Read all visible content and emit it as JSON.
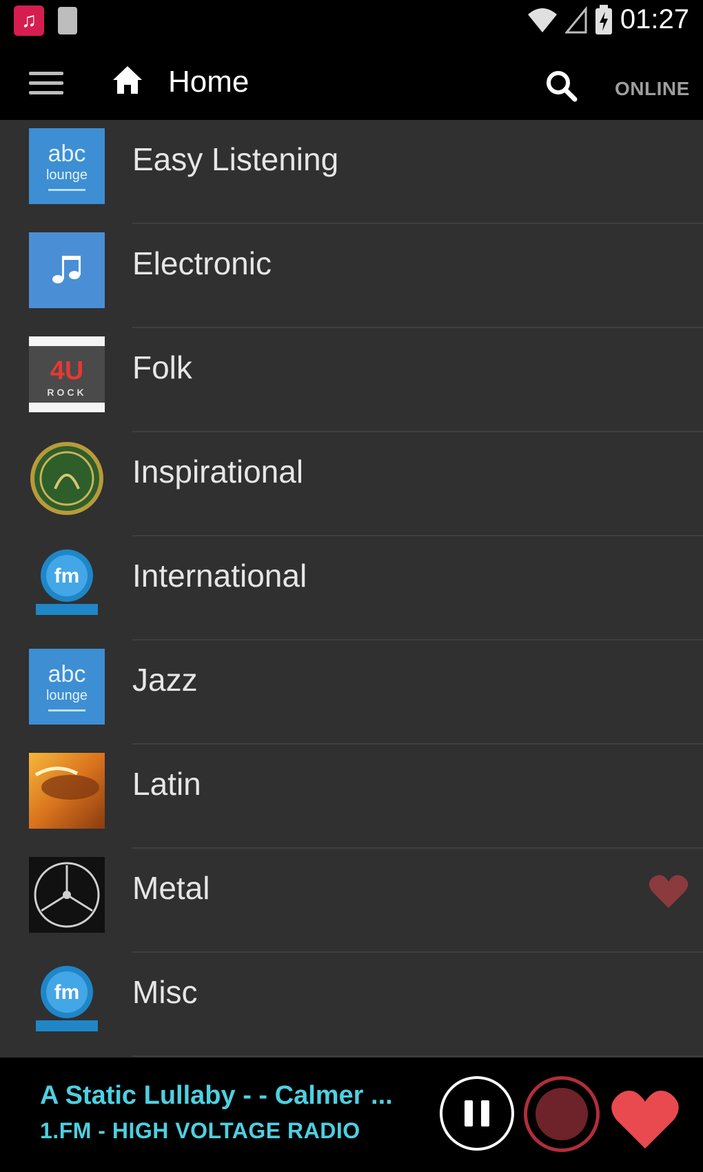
{
  "status_bar": {
    "time": "01:27",
    "app_icon": "music-note-icon",
    "sim_icon": "sim-card-icon",
    "wifi_icon": "wifi-icon",
    "signal_icon": "cell-signal-icon",
    "battery_icon": "battery-charging-icon"
  },
  "toolbar": {
    "title": "Home",
    "menu_icon": "hamburger-menu-icon",
    "home_icon": "home-icon",
    "search_icon": "search-icon",
    "online_label": "ONLINE"
  },
  "genres": [
    {
      "label": "Easy Listening",
      "thumb": "abc-lounge-radio-logo",
      "favorite": false
    },
    {
      "label": "Electronic",
      "thumb": "music-note-icon",
      "favorite": false
    },
    {
      "label": "Folk",
      "thumb": "4u-rock-logo",
      "favorite": false
    },
    {
      "label": "Inspirational",
      "thumb": "green-emblem-logo",
      "favorite": false
    },
    {
      "label": "International",
      "thumb": "fm-radio-logo",
      "favorite": false
    },
    {
      "label": "Jazz",
      "thumb": "abc-lounge-radio-logo",
      "favorite": false
    },
    {
      "label": "Latin",
      "thumb": "latin-station-logo",
      "favorite": false
    },
    {
      "label": "Metal",
      "thumb": "metal-station-logo",
      "favorite": true
    },
    {
      "label": "Misc",
      "thumb": "fm-radio-logo",
      "favorite": false
    }
  ],
  "player": {
    "song": "A Static Lullaby -  - Calmer ...",
    "station": "1.FM - HIGH VOLTAGE RADIO",
    "pause_icon": "pause-icon",
    "record_icon": "record-icon",
    "favorite_icon": "heart-icon"
  },
  "colors": {
    "accent": "#4dd0e1",
    "heart": "#e84a4f",
    "heart_dim": "#8b3a3e",
    "record_ring": "#b12e3a",
    "list_bg": "#303030",
    "bar_bg": "#000000"
  }
}
